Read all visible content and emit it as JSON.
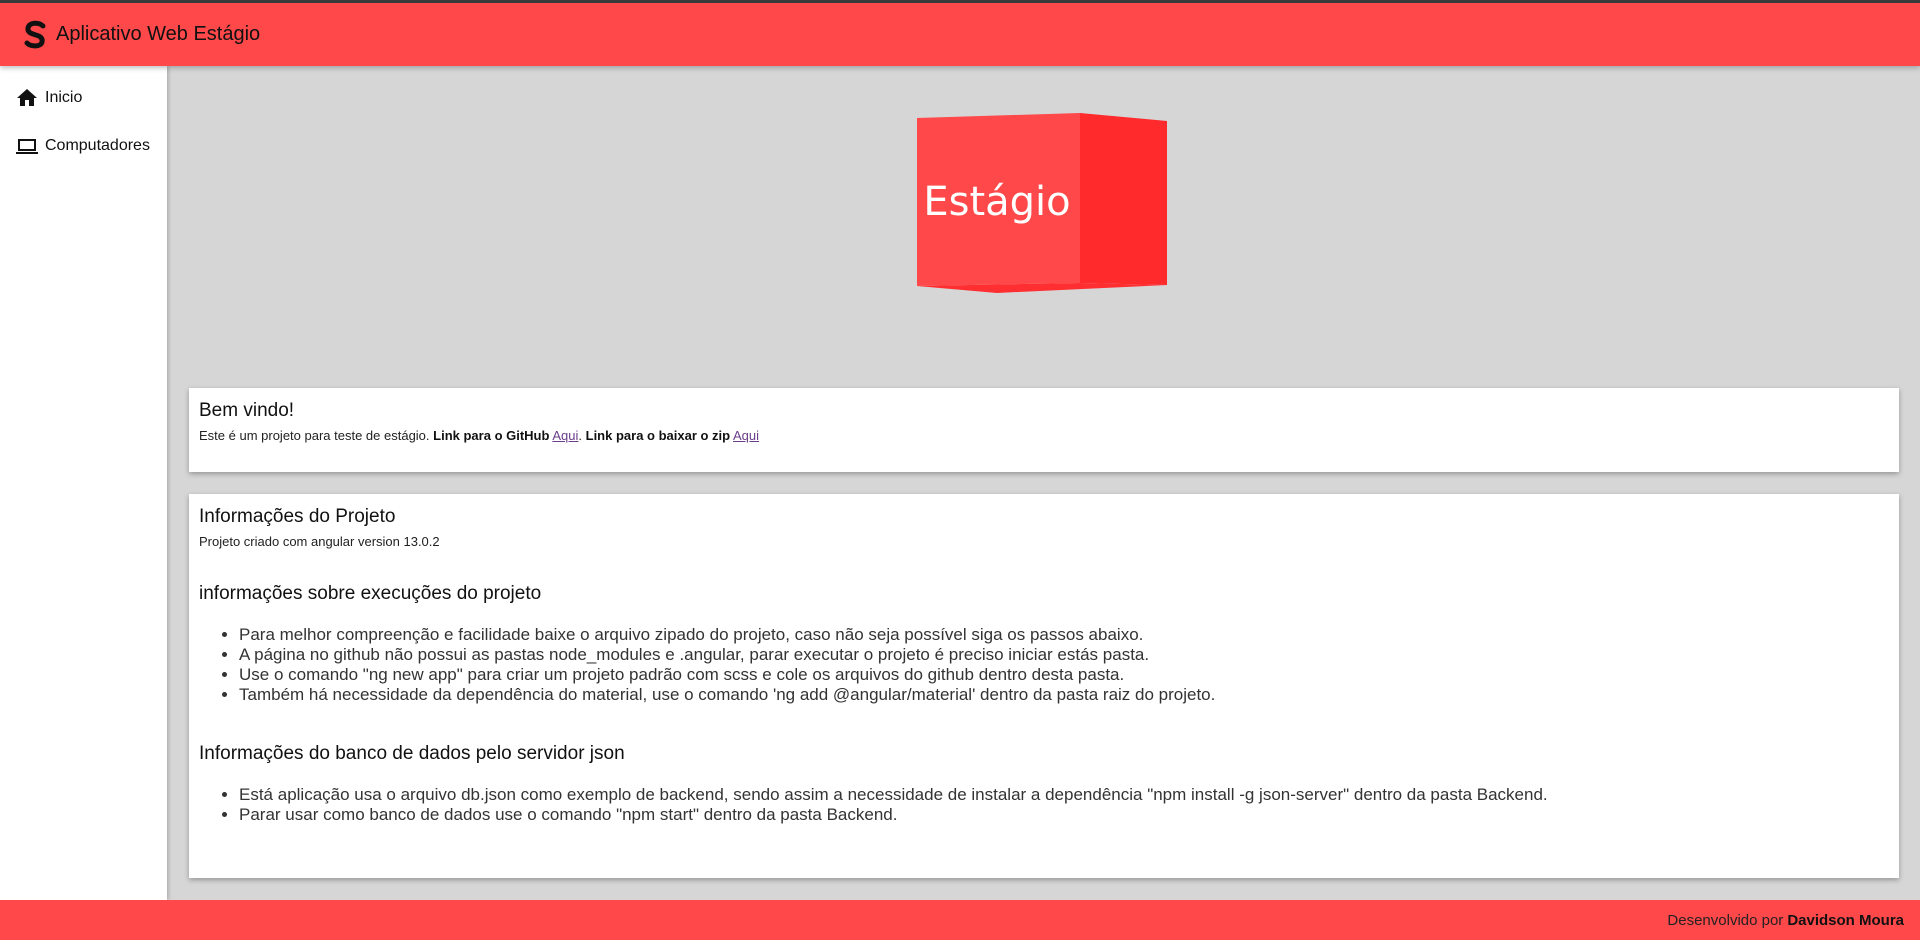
{
  "app": {
    "title": "Aplicativo Web Estágio"
  },
  "sidebar": {
    "items": [
      {
        "label": "Inicio",
        "icon": "home-icon"
      },
      {
        "label": "Computadores",
        "icon": "laptop-icon"
      }
    ]
  },
  "hero": {
    "text": "Estágio"
  },
  "welcome": {
    "title": "Bem vindo!",
    "intro": "Este é um projeto para teste de estágio.",
    "github_label": "Link para o GitHub",
    "github_link": "Aqui",
    "zip_label": "Link para o baixar o zip",
    "zip_link": "Aqui"
  },
  "project_info": {
    "title": "Informações do Projeto",
    "version_text": "Projeto criado com angular version 13.0.2",
    "exec_title": "informações sobre execuções do projeto",
    "exec_items": [
      "Para melhor compreenção e facilidade baixe o arquivo zipado do projeto, caso não seja possível siga os passos abaixo.",
      "A página no github não possui as pastas node_modules e .angular, parar executar o projeto é preciso iniciar estás pasta.",
      "Use o comando \"ng new app\" para criar um projeto padrão com scss e cole os arquivos do github dentro desta pasta.",
      "Também há necessidade da dependência do material, use o comando 'ng add @angular/material' dentro da pasta raiz do projeto."
    ],
    "db_title": "Informações do banco de dados pelo servidor json",
    "db_items": [
      "Está aplicação usa o arquivo db.json como exemplo de backend, sendo assim a necessidade de instalar a dependência \"npm install -g json-server\" dentro da pasta Backend.",
      "Parar usar como banco de dados use o comando \"npm start\" dentro da pasta Backend."
    ]
  },
  "footer": {
    "prefix": "Desenvolvido por",
    "author": "Davidson Moura"
  },
  "colors": {
    "brand": "#ff484a",
    "background": "#d6d6d6"
  }
}
